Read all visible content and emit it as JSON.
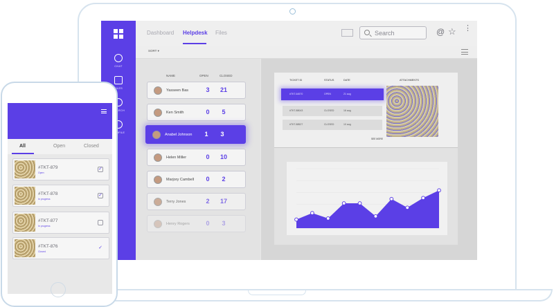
{
  "laptop": {
    "sidebar": {
      "items": [
        {
          "label": "CHAT",
          "icon": "chat-icon"
        },
        {
          "label": "FILES",
          "icon": "copy-icon"
        },
        {
          "label": "SEARCH",
          "icon": "search-icon"
        },
        {
          "label": "PROFILE",
          "icon": "user-icon"
        }
      ]
    },
    "nav": {
      "tabs": [
        {
          "label": "Dashboard"
        },
        {
          "label": "Helpdesk"
        },
        {
          "label": "Files"
        }
      ],
      "active_tab": "Helpdesk"
    },
    "search": {
      "placeholder": "Search"
    },
    "toolbar": {
      "at_symbol": "@",
      "star": "☆",
      "more": "⋮"
    },
    "sort_label": "SORT ▾",
    "agents_table": {
      "headers": {
        "name": "NAME",
        "open": "OPEN",
        "closed": "CLOSED"
      },
      "rows": [
        {
          "name": "Yasseen Bas",
          "open": "3",
          "closed": "21"
        },
        {
          "name": "Ken Smith",
          "open": "0",
          "closed": "5"
        },
        {
          "name": "Anabel Johnson",
          "open": "1",
          "closed": "3"
        },
        {
          "name": "Helen Miller",
          "open": "0",
          "closed": "10"
        },
        {
          "name": "Marjory Cambell",
          "open": "0",
          "closed": "2"
        },
        {
          "name": "Terry Jones",
          "open": "2",
          "closed": "17"
        },
        {
          "name": "Henry Rogers",
          "open": "0",
          "closed": "3"
        }
      ],
      "selected_index": 2
    },
    "tickets_table": {
      "headers": {
        "id": "TICKET ID",
        "status": "STATUS",
        "date": "DATE",
        "attachments": "ATTACHMENTS"
      },
      "rows": [
        {
          "id": "#TKT-64570",
          "status": "OPEN",
          "date": "21 aug"
        },
        {
          "id": "#TKT-88043",
          "status": "CLOSED",
          "date": "16 aug"
        },
        {
          "id": "#TKT-88527",
          "status": "CLOSED",
          "date": "10 aug"
        }
      ],
      "see_more": "SEE MORE"
    },
    "chart_data": {
      "type": "area",
      "x": [
        1,
        2,
        3,
        4,
        5,
        6,
        7,
        8,
        9,
        10
      ],
      "series": [
        {
          "values": [
            8,
            14,
            9,
            23,
            23,
            11,
            27,
            19,
            28,
            35
          ]
        }
      ],
      "ylim": [
        0,
        55
      ],
      "grid": false,
      "color": "#5b3fe6"
    }
  },
  "phone": {
    "tabs": [
      {
        "label": "All"
      },
      {
        "label": "Open"
      },
      {
        "label": "Closed"
      }
    ],
    "active_tab": "All",
    "tickets": [
      {
        "id": "#TKT-879",
        "status": "Open",
        "checked": true
      },
      {
        "id": "#TKT-878",
        "status": "In progress",
        "checked": true
      },
      {
        "id": "#TKT-877",
        "status": "In progress",
        "checked": false
      },
      {
        "id": "#TKT-876",
        "status": "Closed",
        "checked": true
      }
    ]
  },
  "colors": {
    "accent": "#5b3fe6",
    "frame": "#d6e3ee"
  }
}
